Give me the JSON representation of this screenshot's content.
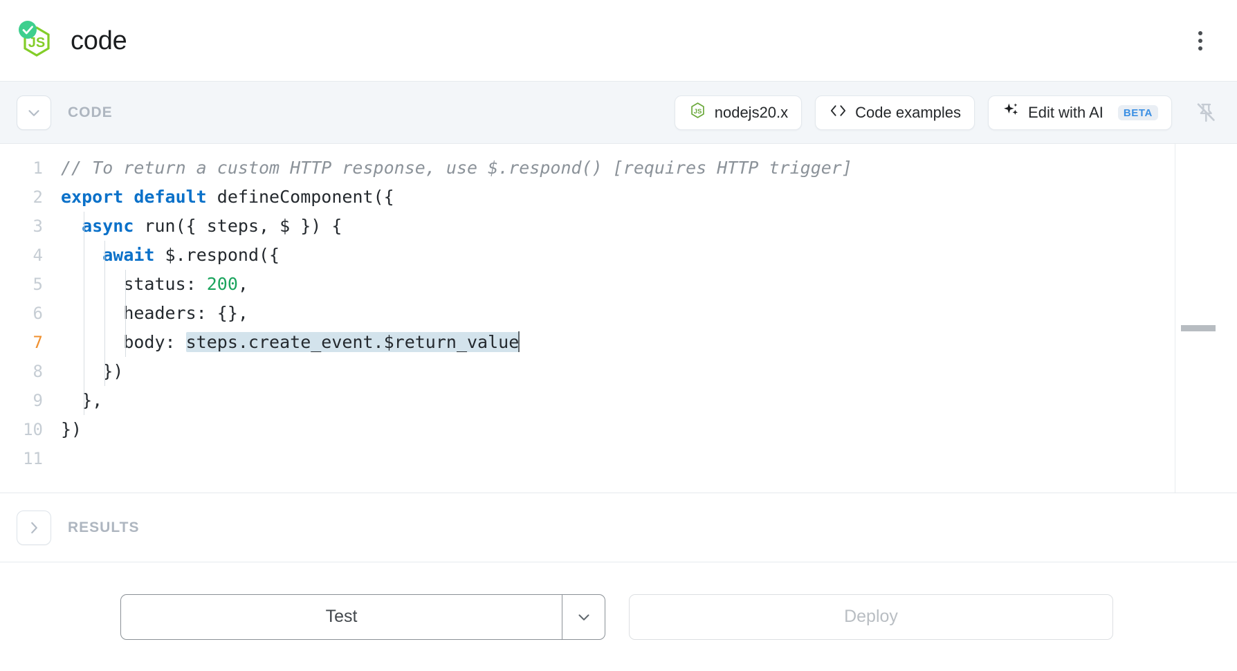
{
  "header": {
    "title": "code",
    "app_icon": "nodejs-hexagon-check-icon",
    "menu_icon": "kebab-menu-icon"
  },
  "code_section": {
    "label": "CODE",
    "collapse_icon": "chevron-down-icon",
    "pin_icon": "pin-off-icon",
    "buttons": [
      {
        "label": "nodejs20.x",
        "icon": "nodejs-hexagon-icon"
      },
      {
        "label": "Code examples",
        "icon": "code-brackets-icon"
      },
      {
        "label": "Edit with AI",
        "icon": "sparkle-ai-icon",
        "badge": "BETA"
      }
    ]
  },
  "editor": {
    "language": "javascript",
    "active_line": 7,
    "cursor_line": 7,
    "selection_text": "steps.create_event.$return_value",
    "lines": [
      {
        "n": "1",
        "text": "// To return a custom HTTP response, use $.respond() [requires HTTP trigger]"
      },
      {
        "n": "2",
        "text": "export default defineComponent({"
      },
      {
        "n": "3",
        "text": "  async run({ steps, $ }) {"
      },
      {
        "n": "4",
        "text": "    await $.respond({"
      },
      {
        "n": "5",
        "text": "      status: 200,"
      },
      {
        "n": "6",
        "text": "      headers: {},"
      },
      {
        "n": "7",
        "text": "      body: steps.create_event.$return_value"
      },
      {
        "n": "8",
        "text": "    })"
      },
      {
        "n": "9",
        "text": "  },"
      },
      {
        "n": "10",
        "text": "})"
      },
      {
        "n": "11",
        "text": ""
      }
    ],
    "tokens": {
      "comment": "// To return a custom HTTP response, use $.respond() [requires HTTP trigger]",
      "kw_export": "export",
      "kw_default": "default",
      "kw_async": "async",
      "kw_await": "await",
      "define_component": " defineComponent({",
      "run_sig": " run({ steps, $ }) {",
      "respond_sig": " $.respond({",
      "status_key": "status: ",
      "status_value": "200",
      "status_comma": ",",
      "headers_line": "headers: {},",
      "body_key": "body: ",
      "body_value": "steps.create_event.$return_value",
      "close_respond": "})",
      "close_run": "},",
      "close_component": "})"
    }
  },
  "results_section": {
    "label": "RESULTS",
    "expand_icon": "chevron-right-icon"
  },
  "footer": {
    "test_label": "Test",
    "test_caret_icon": "chevron-down-icon",
    "deploy_label": "Deploy",
    "deploy_disabled": true
  },
  "colors": {
    "accent_blue": "#0b71c9",
    "keyword_blue": "#0b71c9",
    "number_green": "#1ba45e",
    "active_line_orange": "#f0902f",
    "selection_blue": "#d3e3ec",
    "node_green": "#83cd29",
    "check_green": "#3ecf8e",
    "toolbar_bg": "#f3f6f9",
    "beta_blue": "#3b8fe3"
  }
}
